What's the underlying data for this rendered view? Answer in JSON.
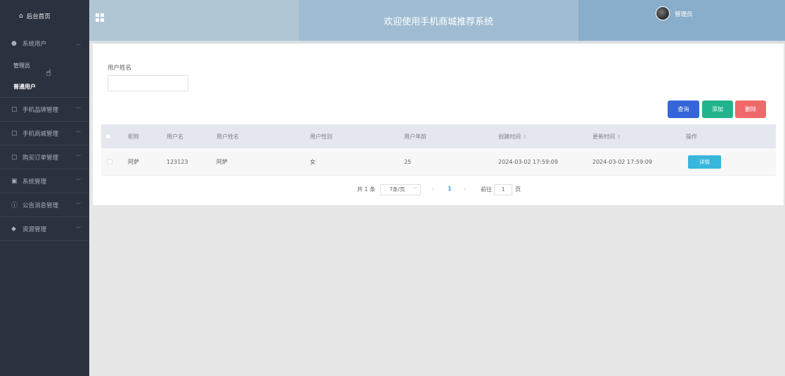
{
  "sidebar": {
    "home_label": "后台首页",
    "groups": [
      {
        "label": "系统用户",
        "items": [
          "管理员",
          "普通用户"
        ]
      },
      {
        "label": "手机品牌管理"
      },
      {
        "label": "手机商城管理"
      },
      {
        "label": "购买订单管理"
      },
      {
        "label": "系统管理"
      },
      {
        "label": "公告消息管理"
      },
      {
        "label": "资源管理"
      }
    ]
  },
  "header": {
    "title": "欢迎使用手机商城推荐系统",
    "user": "管理员"
  },
  "search": {
    "label": "用户姓名",
    "value": ""
  },
  "buttons": {
    "query": "查询",
    "add": "添加",
    "delete": "删除"
  },
  "table": {
    "columns": [
      "昵称",
      "用户名",
      "用户姓名",
      "用户性别",
      "用户年龄",
      "创建时间",
      "更新时间",
      "操作"
    ],
    "rows": [
      {
        "nickname": "阿萨",
        "username": "123123",
        "realname": "阿萨",
        "gender": "女",
        "age": "25",
        "created": "2024-03-02 17:59:09",
        "updated": "2024-03-02 17:59:09",
        "action": "详情"
      }
    ]
  },
  "pagination": {
    "total": "共 1 条",
    "page_size": "7条/页",
    "current": "1",
    "goto_label": "前往",
    "goto_value": "1",
    "page_suffix": "页"
  },
  "colors": {
    "sidebar_bg": "#2b323f",
    "query": "#3565d8",
    "add": "#21b48c",
    "delete": "#f0696a",
    "detail": "#39b6dc",
    "active_page": "#409eff"
  }
}
